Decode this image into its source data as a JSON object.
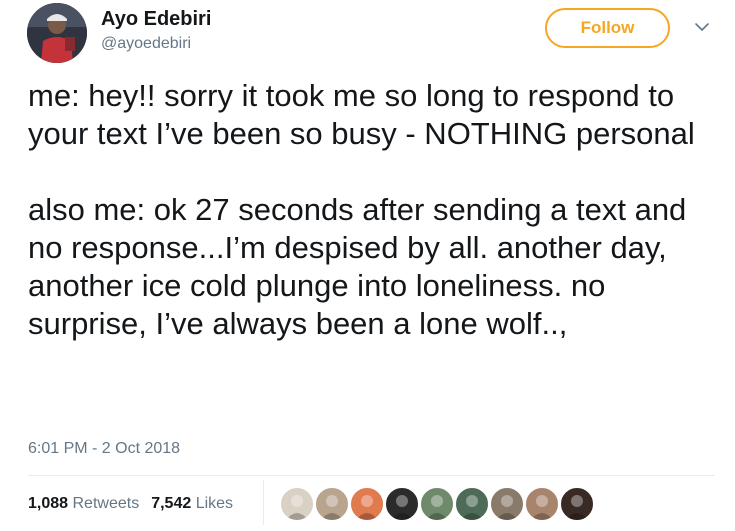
{
  "author": {
    "name": "Ayo Edebiri",
    "handle": "@ayoedebiri"
  },
  "follow_button": {
    "label": "Follow",
    "color": "#f5a623"
  },
  "menu_icon": "chevron-down-icon",
  "tweet": {
    "paragraph1": "me: hey!! sorry it took me so long to respond to your text I’ve been so busy - NOTHING personal",
    "paragraph2": "also me: ok 27 seconds after sending a text and no response...I’m despised by all. another day, another ice cold plunge into loneliness. no surprise, I’ve always been a lone wolf..,",
    "timestamp": "6:01 PM - 2 Oct 2018"
  },
  "stats": {
    "retweets_count": "1,088",
    "retweets_label": "Retweets",
    "likes_count": "7,542",
    "likes_label": "Likes"
  },
  "liker_avatar_colors": [
    "#d9d2c4",
    "#b9a48e",
    "#e07a4f",
    "#2b2b2b",
    "#6f8a6a",
    "#4e6b58",
    "#8a7a6a",
    "#a8846c",
    "#3a2a26"
  ],
  "colors": {
    "text": "#14171a",
    "secondary": "#657786",
    "divider": "#e6ecf0"
  }
}
